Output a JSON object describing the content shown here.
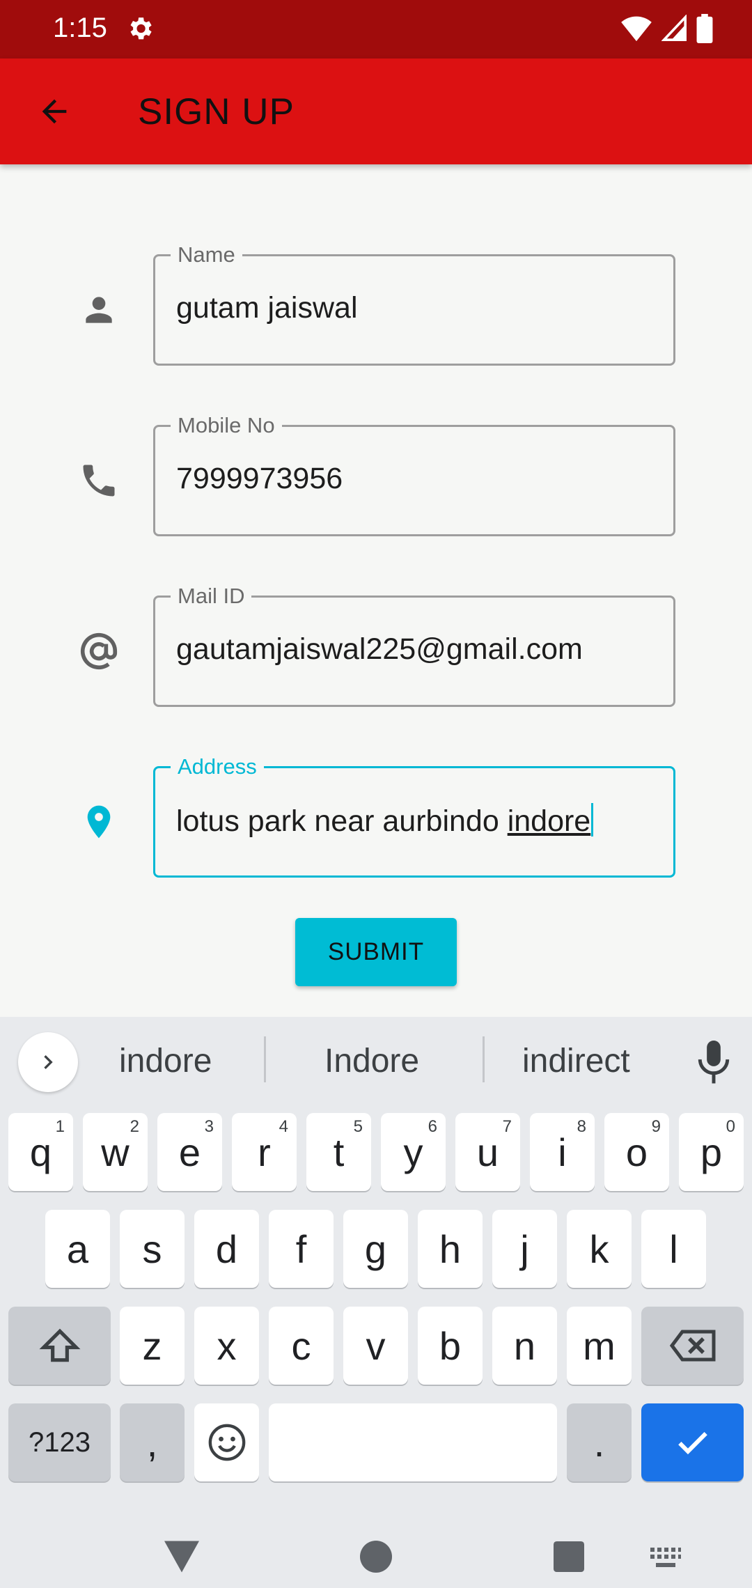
{
  "status_bar": {
    "time": "1:15"
  },
  "app_bar": {
    "title": "SIGN UP"
  },
  "form": {
    "name": {
      "label": "Name",
      "value": "gutam jaiswal"
    },
    "mobile": {
      "label": "Mobile No",
      "value": "7999973956"
    },
    "mail": {
      "label": "Mail ID",
      "value": "gautamjaiswal225@gmail.com"
    },
    "address": {
      "label": "Address",
      "value_prefix": "lotus park near aurbindo ",
      "value_composing": "indore"
    },
    "submit_label": "SUBMIT"
  },
  "colors": {
    "status_bar": "#a00c0c",
    "app_bar": "#dc1112",
    "accent": "#00b8d4",
    "enter_key": "#1a73e8"
  },
  "keyboard": {
    "suggestions": [
      "indore",
      "Indore",
      "indirect"
    ],
    "row1": [
      {
        "key": "q",
        "hint": "1"
      },
      {
        "key": "w",
        "hint": "2"
      },
      {
        "key": "e",
        "hint": "3"
      },
      {
        "key": "r",
        "hint": "4"
      },
      {
        "key": "t",
        "hint": "5"
      },
      {
        "key": "y",
        "hint": "6"
      },
      {
        "key": "u",
        "hint": "7"
      },
      {
        "key": "i",
        "hint": "8"
      },
      {
        "key": "o",
        "hint": "9"
      },
      {
        "key": "p",
        "hint": "0"
      }
    ],
    "row2": [
      "a",
      "s",
      "d",
      "f",
      "g",
      "h",
      "j",
      "k",
      "l"
    ],
    "row3": [
      "z",
      "x",
      "c",
      "v",
      "b",
      "n",
      "m"
    ],
    "symbols_label": "?123",
    "comma": ",",
    "period": "."
  }
}
